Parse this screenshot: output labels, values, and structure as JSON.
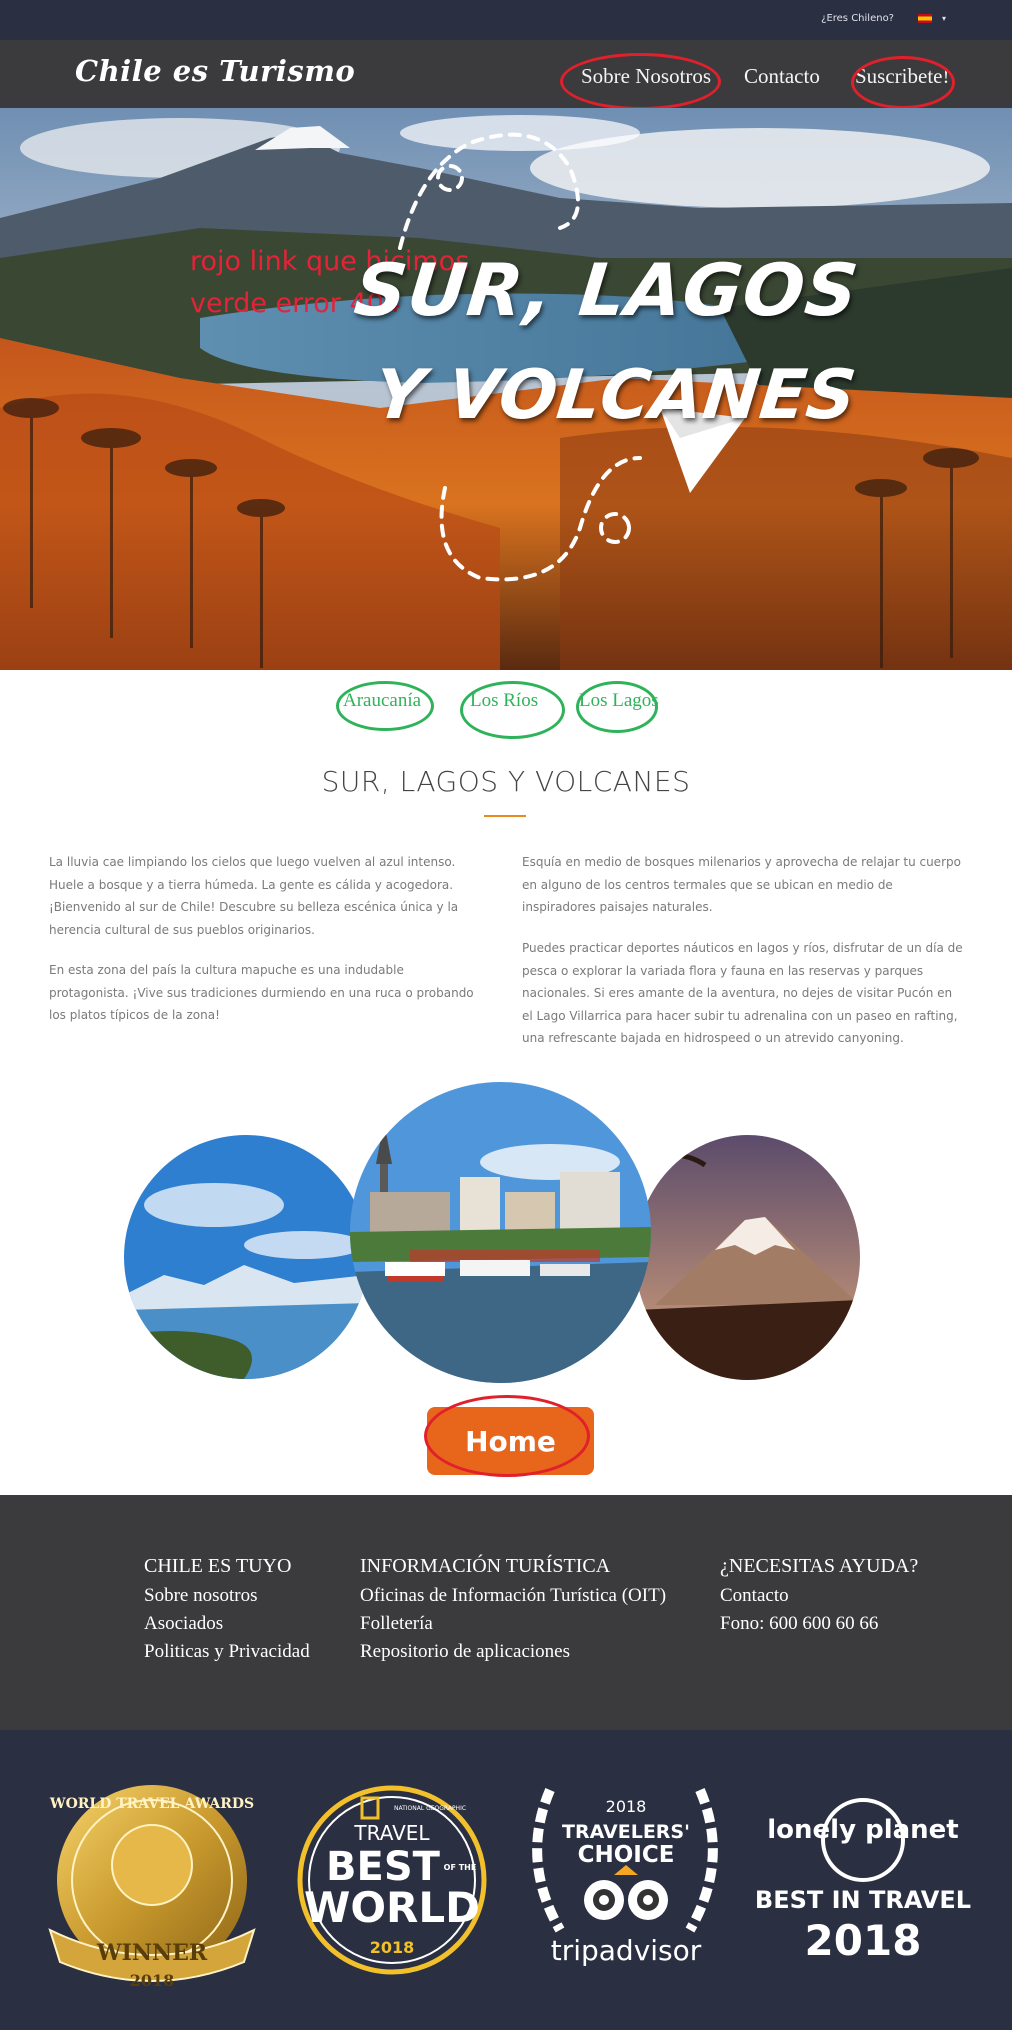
{
  "topbar": {
    "chilean_question": "¿Eres Chileno?",
    "language_flag": "spain-flag-icon",
    "caret": "▾"
  },
  "navbar": {
    "logo": "Chile es Turismo",
    "items": [
      "Sobre Nosotros",
      "Contacto",
      "Suscribete!"
    ]
  },
  "hero": {
    "annotation_lines": [
      "rojo link que hicimos",
      "verde error 404"
    ],
    "title_lines": [
      "SUR, LAGOS",
      "Y VOLCANES"
    ]
  },
  "subnav": {
    "items": [
      "Araucanía",
      "Los Ríos",
      "Los Lagos"
    ]
  },
  "section": {
    "title": "SUR, LAGOS Y VOLCANES",
    "left_paragraphs": [
      "La lluvia cae limpiando los cielos que luego vuelven al azul intenso. Huele a bosque y a tierra húmeda. La gente es cálida y acogedora. ¡Bienvenido al sur de Chile! Descubre su belleza escénica única y la herencia cultural de sus pueblos originarios.",
      "En esta zona del país la cultura mapuche es una indudable protagonista. ¡Vive sus tradiciones durmiendo en una ruca o probando los platos típicos de la zona!"
    ],
    "right_paragraphs": [
      "Esquía en medio de bosques milenarios y aprovecha de relajar tu cuerpo en alguno de los centros termales que se ubican en medio de inspiradores paisajes naturales.",
      "Puedes practicar deportes náuticos en lagos y ríos, disfrutar de un día de pesca o explorar la variada flora y fauna en las reservas y parques nacionales. Si eres amante de la aventura, no dejes de visitar Pucón en el Lago Villarrica para hacer subir tu adrenalina con un paseo en rafting, una refrescante bajada en hidrospeed o un atrevido canyoning."
    ]
  },
  "gallery": {
    "images": [
      "lake-mountain-photo",
      "city-port-photo",
      "volcano-photo"
    ]
  },
  "home_button": "Home",
  "footer": {
    "columns": [
      {
        "heading": "CHILE ES TUYO",
        "links": [
          "Sobre nosotros",
          "Asociados",
          "Politicas y Privacidad"
        ]
      },
      {
        "heading": "INFORMACIÓN TURÍSTICA",
        "links": [
          "Oficinas de Información Turística (OIT)",
          "Folletería",
          "Repositorio de aplicaciones"
        ]
      },
      {
        "heading": "¿NECESITAS AYUDA?",
        "links": [
          "Contacto",
          "Fono: 600 600 60 66"
        ]
      }
    ]
  },
  "awards": {
    "world_travel": {
      "top": "WORLD TRAVEL AWARDS",
      "ribbon": "WINNER",
      "year": "2018"
    },
    "natgeo": {
      "brand": "NATIONAL GEOGRAPHIC",
      "line1": "TRAVEL",
      "line2": "BEST",
      "of_the": "OF THE",
      "line3": "WORLD",
      "year": "2018"
    },
    "tripadvisor": {
      "year": "2018",
      "line1": "TRAVELERS'",
      "line2": "CHOICE",
      "brand": "tripadvisor"
    },
    "lonely_planet": {
      "brand": "lonely planet",
      "line1": "BEST IN TRAVEL",
      "year": "2018"
    }
  },
  "colors": {
    "topbar": "#2b2f42",
    "navbar": "#3b3b3d",
    "accent": "#e8651c",
    "annotation_red": "#e0202a",
    "annotation_green": "#2fb35a"
  }
}
